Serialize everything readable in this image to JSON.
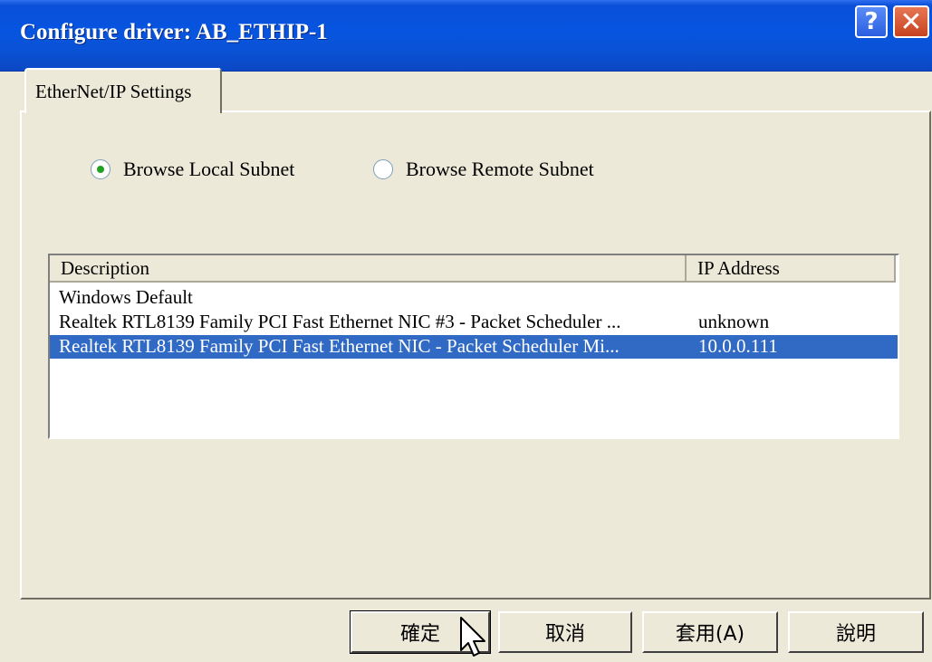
{
  "window": {
    "title": "Configure driver: AB_ETHIP-1",
    "help_glyph": "?",
    "close_glyph": "✕"
  },
  "tabs": [
    {
      "label": "EtherNet/IP Settings"
    }
  ],
  "radios": [
    {
      "label": "Browse Local Subnet",
      "selected": true
    },
    {
      "label": "Browse Remote Subnet",
      "selected": false
    }
  ],
  "list": {
    "columns": [
      "Description",
      "IP Address"
    ],
    "rows": [
      {
        "description": "Windows Default",
        "ip": ""
      },
      {
        "description": "Realtek RTL8139 Family PCI Fast Ethernet NIC #3 - Packet Scheduler ...",
        "ip": "unknown"
      },
      {
        "description": "Realtek RTL8139 Family PCI Fast Ethernet NIC - Packet Scheduler Mi...",
        "ip": "10.0.0.111",
        "selected": true
      }
    ]
  },
  "buttons": {
    "ok": "確定",
    "cancel": "取消",
    "apply": "套用(A)",
    "help": "說明"
  },
  "colors": {
    "title_bar": "#0a53d6",
    "selection": "#316ac5",
    "dialog_bg": "#ece9d8",
    "radio_dot": "#21a121"
  }
}
